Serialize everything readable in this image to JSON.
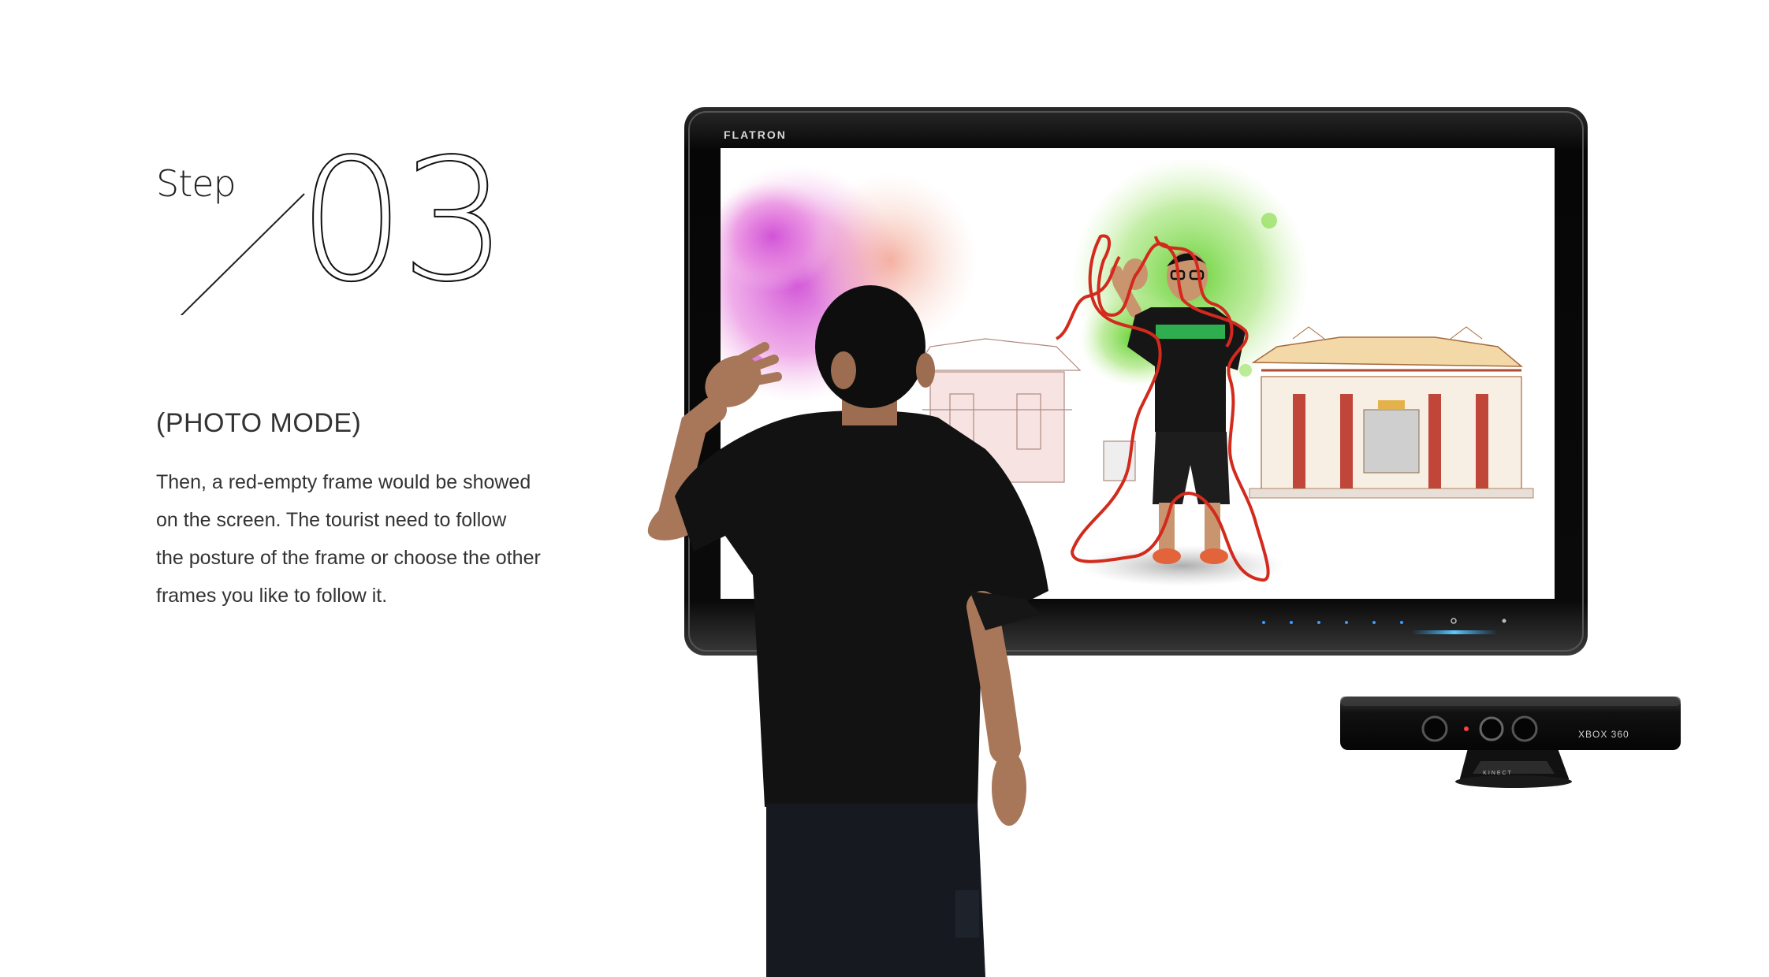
{
  "step": {
    "label": "Step",
    "number": "03"
  },
  "mode_title": "(PHOTO MODE)",
  "description_lines": [
    "Then, a red-empty frame would be showed",
    "on the screen. The tourist need to follow",
    "the posture of the frame or choose the other",
    "frames you like to follow it."
  ],
  "monitor": {
    "brand": "FLATRON"
  },
  "sensor": {
    "brand": "XBOX 360",
    "sub_brand": "KINECT"
  },
  "colors": {
    "outline_red": "#d22a1c",
    "monitor_black": "#0d0d0d",
    "splash_pink": "#e06ad8",
    "splash_green": "#7fd93a",
    "shirt_stripe": "#2fae4f"
  }
}
